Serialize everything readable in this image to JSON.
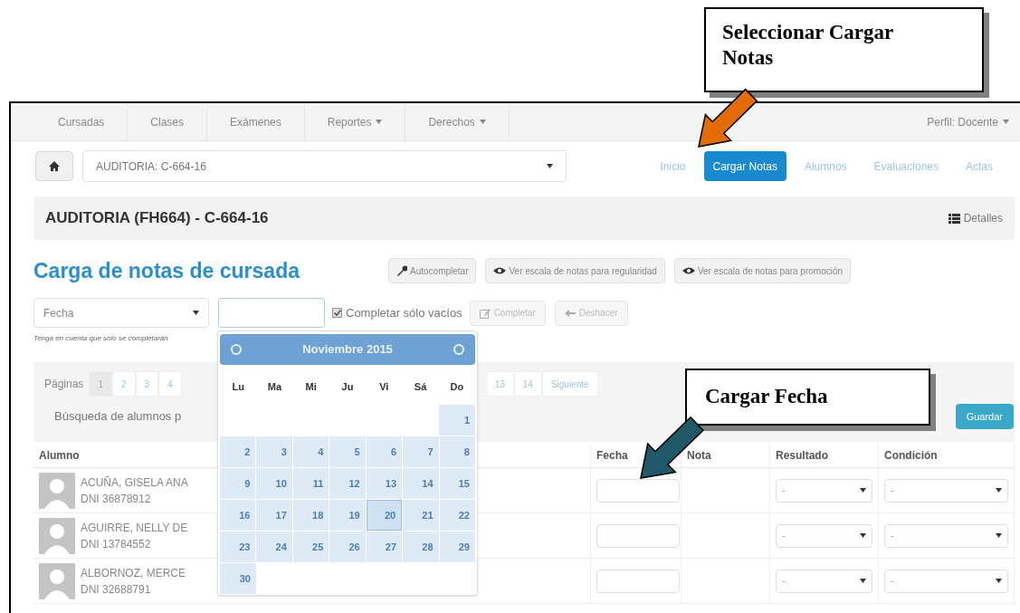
{
  "navbar": {
    "items": [
      {
        "label": "Cursadas",
        "caret": false
      },
      {
        "label": "Clases",
        "caret": false
      },
      {
        "label": "Exámenes",
        "caret": false
      },
      {
        "label": "Reportes",
        "caret": true
      },
      {
        "label": "Derechos",
        "caret": true
      }
    ],
    "profile": {
      "label": "Perfil: Docente",
      "caret": true
    }
  },
  "course_select": {
    "value": "AUDITORIA: C-664-16"
  },
  "nav_pills": [
    {
      "label": "Inicio",
      "selected": false
    },
    {
      "label": "Cargar Notas",
      "selected": true
    },
    {
      "label": "Alumnos",
      "selected": false
    },
    {
      "label": "Evaluaciones",
      "selected": false
    },
    {
      "label": "Actas",
      "selected": false
    }
  ],
  "header": {
    "title": "AUDITORIA (FH664) - C-664-16",
    "details": "Detalles"
  },
  "page_title": "Carga de notas de cursada",
  "scale_buttons": [
    {
      "label": "Autocompletar",
      "kind": "wrench"
    },
    {
      "label": "Ver escala de notas para regularidad",
      "kind": "eye"
    },
    {
      "label": "Ver escala de notas para promoción",
      "kind": "eye"
    }
  ],
  "fill_controls": {
    "field_select": "Fecha",
    "only_empty": {
      "label": "Completar sólo vacíos",
      "checked": true
    },
    "buttons": [
      {
        "label": "Completar",
        "kind": "edit",
        "disabled": true
      },
      {
        "label": "Deshacer",
        "kind": "back",
        "disabled": true
      }
    ]
  },
  "note": "Tenga en cuenta que sólo se completarán",
  "pagination": {
    "label": "Páginas",
    "pages_before": [
      {
        "label": "1",
        "selected": true
      },
      {
        "label": "2",
        "selected": false
      },
      {
        "label": "3",
        "selected": false
      },
      {
        "label": "4",
        "selected": false
      }
    ],
    "pages_after": [
      {
        "label": "13",
        "selected": false
      },
      {
        "label": "14",
        "selected": false
      },
      {
        "label": "Siguiente",
        "selected": false
      }
    ]
  },
  "search_label": "Búsqueda de alumnos p",
  "save_button": "Guardar",
  "table": {
    "columns": [
      "Alumno",
      "Fecha",
      "Nota",
      "Resultado",
      "Condición"
    ],
    "rows": [
      {
        "name": "ACUÑA, GISELA ANA",
        "dni": "DNI 36878912",
        "result": "-",
        "condition": "-"
      },
      {
        "name": "AGUIRRE, NELLY DE",
        "dni": "DNI 13784552",
        "result": "-",
        "condition": "-"
      },
      {
        "name": "ALBORNOZ, MERCE",
        "dni": "DNI 32688791",
        "result": "-",
        "condition": "-"
      }
    ]
  },
  "calendar": {
    "month": "Noviembre 2015",
    "weekdays": [
      "Lu",
      "Ma",
      "Mi",
      "Ju",
      "Vi",
      "Sá",
      "Do"
    ],
    "weeks": [
      {
        "days": [
          {
            "label": "1",
            "selected": false
          }
        ]
      },
      {
        "days": [
          {
            "label": "2",
            "selected": false
          },
          {
            "label": "3",
            "selected": false
          },
          {
            "label": "4",
            "selected": false
          },
          {
            "label": "5",
            "selected": false
          },
          {
            "label": "6",
            "selected": false
          },
          {
            "label": "7",
            "selected": false
          },
          {
            "label": "8",
            "selected": false
          }
        ]
      },
      {
        "days": [
          {
            "label": "9",
            "selected": false
          },
          {
            "label": "10",
            "selected": false
          },
          {
            "label": "11",
            "selected": false
          },
          {
            "label": "12",
            "selected": false
          },
          {
            "label": "13",
            "selected": false
          },
          {
            "label": "14",
            "selected": false
          },
          {
            "label": "15",
            "selected": false
          }
        ]
      },
      {
        "days": [
          {
            "label": "16",
            "selected": false
          },
          {
            "label": "17",
            "selected": false
          },
          {
            "label": "18",
            "selected": false
          },
          {
            "label": "19",
            "selected": false
          },
          {
            "label": "20",
            "selected": true
          },
          {
            "label": "21",
            "selected": false
          },
          {
            "label": "22",
            "selected": false
          }
        ]
      },
      {
        "days": [
          {
            "label": "23",
            "selected": false
          },
          {
            "label": "24",
            "selected": false
          },
          {
            "label": "25",
            "selected": false
          },
          {
            "label": "26",
            "selected": false
          },
          {
            "label": "27",
            "selected": false
          },
          {
            "label": "28",
            "selected": false
          },
          {
            "label": "29",
            "selected": false
          }
        ]
      },
      {
        "days": [
          {
            "label": "30",
            "selected": false
          }
        ]
      }
    ]
  },
  "callouts": [
    {
      "text": "Seleccionar Cargar Notas",
      "color": "#e36c09"
    },
    {
      "text": "Cargar Fecha",
      "color": "#215868"
    }
  ]
}
